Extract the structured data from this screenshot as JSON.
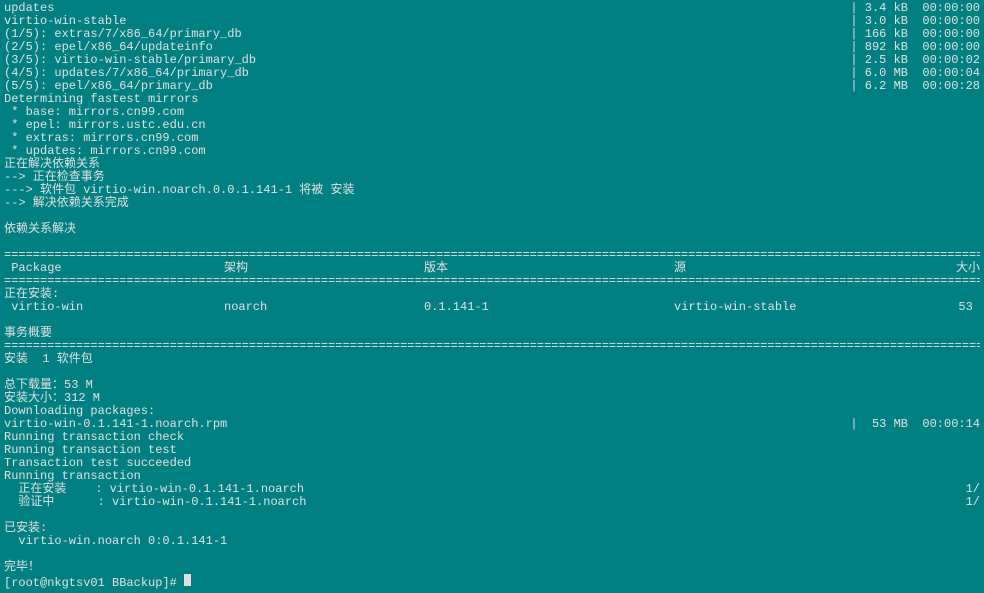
{
  "repos": [
    {
      "name": "updates",
      "size": "3.4 kB",
      "time": "00:00:00"
    },
    {
      "name": "virtio-win-stable",
      "size": "3.0 kB",
      "time": "00:00:00"
    },
    {
      "name": "(1/5): extras/7/x86_64/primary_db",
      "size": "166 kB",
      "time": "00:00:00"
    },
    {
      "name": "(2/5): epel/x86_64/updateinfo",
      "size": "892 kB",
      "time": "00:00:00"
    },
    {
      "name": "(3/5): virtio-win-stable/primary_db",
      "size": "2.5 kB",
      "time": "00:00:02"
    },
    {
      "name": "(4/5): updates/7/x86_64/primary_db",
      "size": "6.0 MB",
      "time": "00:00:04"
    },
    {
      "name": "(5/5): epel/x86_64/primary_db",
      "size": "6.2 MB",
      "time": "00:00:28"
    }
  ],
  "mirrors": {
    "heading": "Determining fastest mirrors",
    "lines": [
      " * base: mirrors.cn99.com",
      " * epel: mirrors.ustc.edu.cn",
      " * extras: mirrors.cn99.com",
      " * updates: mirrors.cn99.com"
    ]
  },
  "dep": {
    "l1": "正在解决依赖关系",
    "l2": "--> 正在检查事务",
    "l3": "---> 软件包 virtio-win.noarch.0.0.1.141-1 将被 安装",
    "l4": "--> 解决依赖关系完成",
    "l5": "依赖关系解决"
  },
  "tbl": {
    "h_pkg": " Package",
    "h_arch": "架构",
    "h_ver": "版本",
    "h_repo": "源",
    "h_size": "大小",
    "installing_label": "正在安装:",
    "pkg": " virtio-win",
    "arch": "noarch",
    "ver": "0.1.141-1",
    "repo": "virtio-win-stable",
    "size": "53 "
  },
  "summary": {
    "title": "事务概要",
    "l1": "安装  1 软件包",
    "l2": "总下载量：53 M",
    "l3": "安装大小：312 M",
    "l4": "Downloading packages:",
    "dl_name": "virtio-win-0.1.141-1.noarch.rpm",
    "dl_size": "53 MB",
    "dl_time": "00:00:14",
    "l5": "Running transaction check",
    "l6": "Running transaction test",
    "l7": "Transaction test succeeded",
    "l8": "Running transaction",
    "l9": "  正在安装    : virtio-win-0.1.141-1.noarch",
    "l9r": "1/",
    "l10": "  验证中      : virtio-win-0.1.141-1.noarch",
    "l10r": "1/",
    "installed": "已安装:",
    "installed_pkg": "  virtio-win.noarch 0:0.1.141-1",
    "done": "完毕！"
  },
  "prompt": "[root@nkgtsv01 BBackup]#"
}
